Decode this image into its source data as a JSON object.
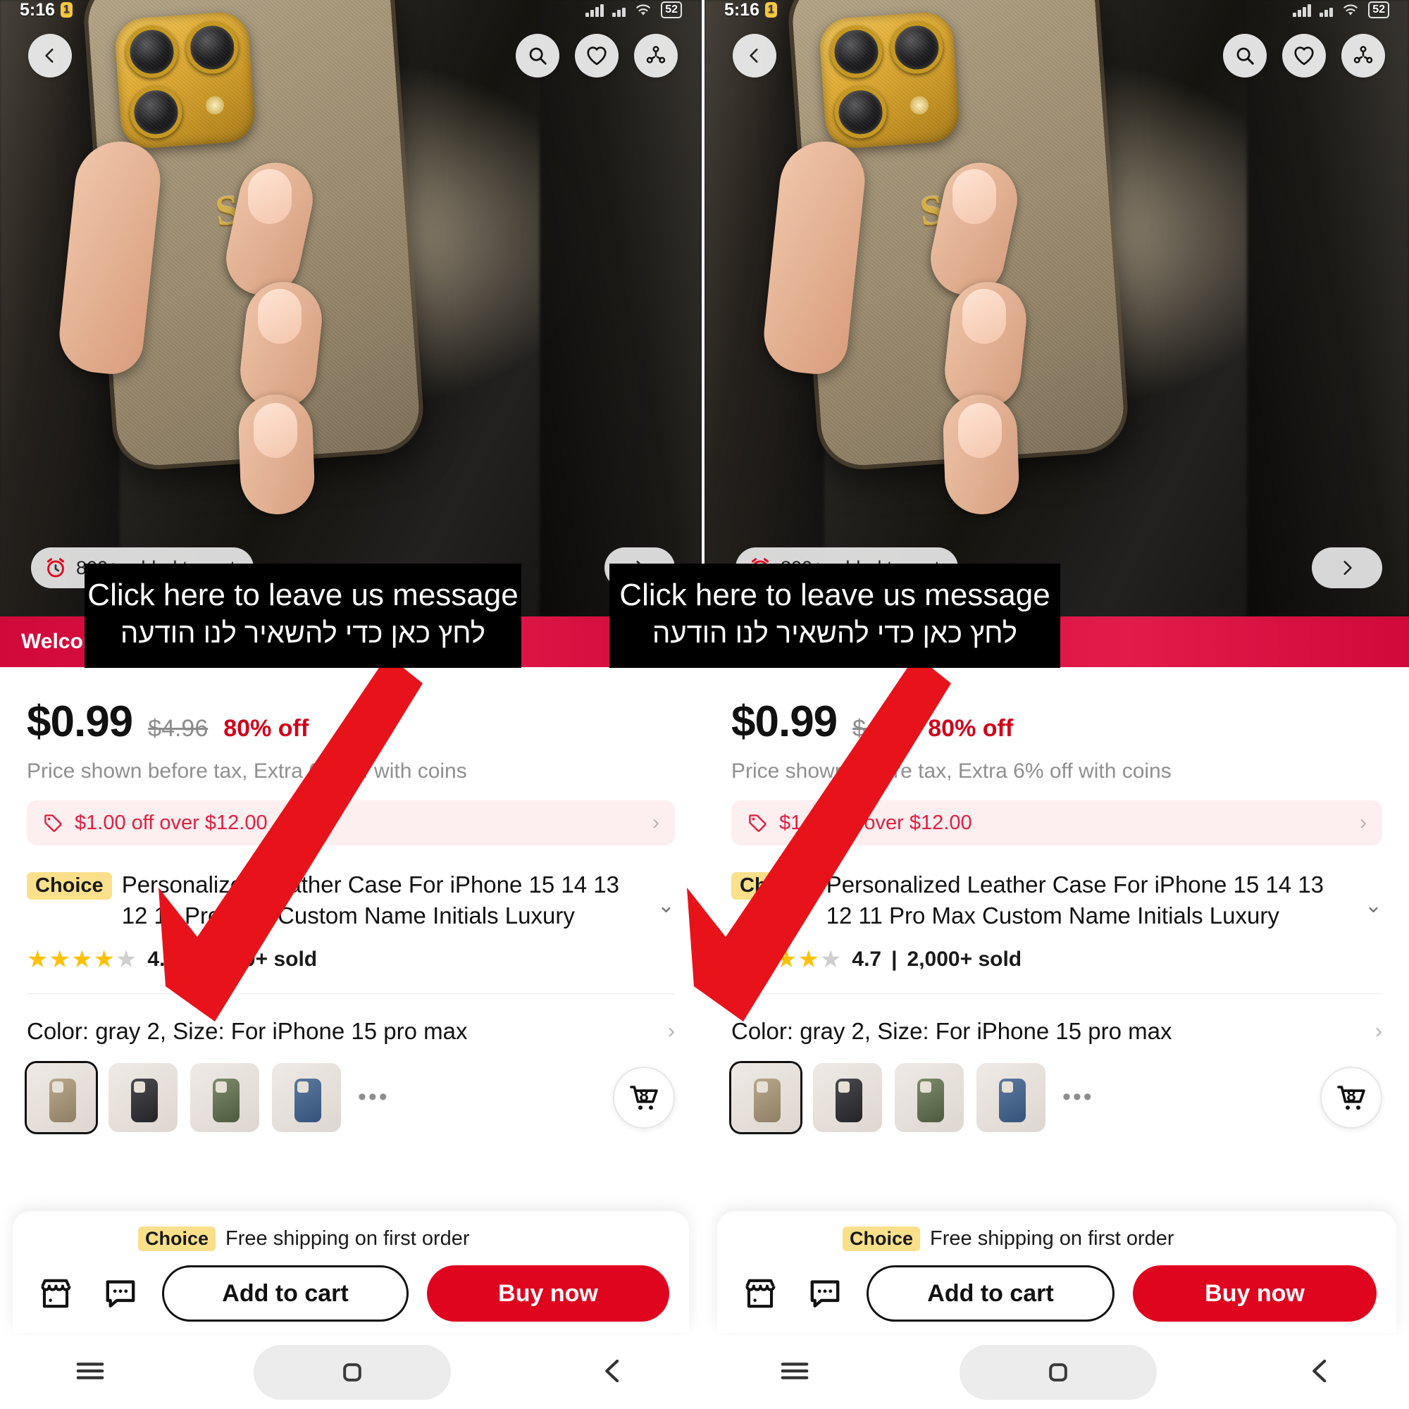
{
  "status_bar": {
    "time": "5:16",
    "notif_badge": "1",
    "battery": "52"
  },
  "hero": {
    "initials": "S.K",
    "added_to_cart": "800+ added to cart",
    "back_icon": "chevron-left-icon",
    "search_icon": "search-icon",
    "wishlist_icon": "heart-icon",
    "share_icon": "share-icon",
    "alarm_icon": "alarm-clock-icon",
    "next_icon": "chevron-right-icon"
  },
  "ribbon": {
    "text": "Welcome deal"
  },
  "tooltip": {
    "line1": "Click here to leave us message",
    "line2": "לחץ כאן כדי להשאיר לנו הודעה"
  },
  "price": {
    "current": "$0.99",
    "original": "$4.96",
    "discount": "80% off",
    "tax_note": "Price shown before tax, Extra 6% off with coins"
  },
  "coupon": {
    "icon": "tag-icon",
    "text": "$1.00 off over $12.00",
    "chevron": "›"
  },
  "product": {
    "choice_tag": "Choice",
    "title": "Personalized Leather Case For iPhone 15 14 13 12 11 Pro Max Custom Name Initials Luxury",
    "expand_chevron": "⌄",
    "rating_value": "4.7",
    "rating_separator": "|",
    "sold": "2,000+ sold",
    "stars_full": 4,
    "stars_half": 1
  },
  "variant": {
    "label": "Color: gray 2, Size: For iPhone 15 pro max",
    "chevron": "›"
  },
  "thumbnails": {
    "more": "•••",
    "cart_count": "8",
    "cart_icon": "shopping-cart-icon",
    "items": [
      {
        "name": "thumb-gray-2",
        "selected": true
      },
      {
        "name": "thumb-black",
        "selected": false
      },
      {
        "name": "thumb-green",
        "selected": false
      },
      {
        "name": "thumb-blue",
        "selected": false
      }
    ]
  },
  "bottom_bar": {
    "ship_tag": "Choice",
    "ship_text": "Free shipping on first order",
    "store_icon": "store-icon",
    "message_icon": "chat-message-icon",
    "add_to_cart": "Add to cart",
    "buy_now": "Buy now"
  },
  "navbar": {
    "recents_icon": "menu-recents-icon",
    "home_icon": "home-square-icon",
    "back_icon": "back-chevron-icon"
  },
  "colors": {
    "brand_red": "#e0051f",
    "discount_red": "#d0021b",
    "coupon_bg": "#fdeef0",
    "choice_yellow": "#fae08a",
    "star_yellow": "#ffc107",
    "arrow_red": "#e8121a",
    "ribbon_red": "#d1093b"
  }
}
